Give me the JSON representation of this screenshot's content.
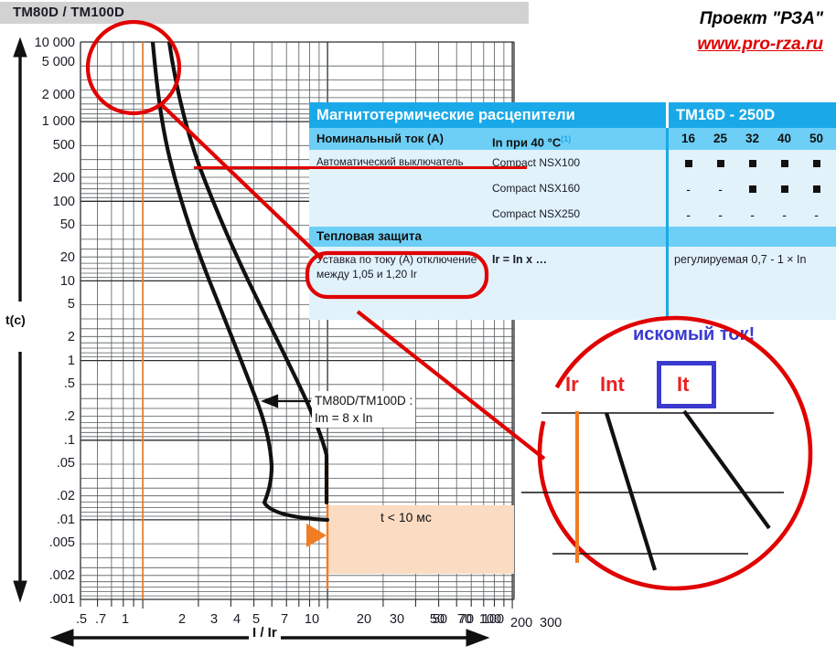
{
  "title_bar": {
    "text": "TM80D / TM100D"
  },
  "brand": {
    "line1": "Проект \"РЗА\"",
    "line2": "www.pro-rza.ru",
    "color": "#e00000"
  },
  "chart_data": {
    "type": "line",
    "title": "TM80D / TM100D",
    "xlabel": "I / Ir",
    "ylabel": "t(c)",
    "xscale": "log",
    "yscale": "log",
    "xlim": [
      0.5,
      300
    ],
    "ylim": [
      0.001,
      10000
    ],
    "grid": true,
    "xticks": [
      ".5",
      ".7",
      "1",
      "2",
      "3",
      "4",
      "5",
      "7",
      "10",
      "20",
      "30",
      "50",
      "70",
      "100",
      "200",
      "300"
    ],
    "xtick_values": [
      0.5,
      0.7,
      1,
      2,
      3,
      4,
      5,
      7,
      10,
      20,
      30,
      50,
      70,
      100,
      200,
      300
    ],
    "yticks": [
      "10 000",
      "5 000",
      "2 000",
      "1 000",
      "500",
      "200",
      "100",
      "50",
      "20",
      "10",
      "5",
      "2",
      "1",
      ".5",
      ".2",
      ".1",
      ".05",
      ".02",
      ".01",
      ".005",
      ".002",
      ".001"
    ],
    "ytick_values": [
      10000,
      5000,
      2000,
      1000,
      500,
      200,
      100,
      50,
      20,
      10,
      5,
      2,
      1,
      0.5,
      0.2,
      0.1,
      0.05,
      0.02,
      0.01,
      0.005,
      0.002,
      0.001
    ],
    "series": [
      {
        "name": "thermal-curve-upper",
        "color": "#111111",
        "points": [
          [
            1.08,
            10000
          ],
          [
            1.15,
            2000
          ],
          [
            1.3,
            500
          ],
          [
            1.6,
            100
          ],
          [
            2.0,
            30
          ],
          [
            2.6,
            10
          ],
          [
            3.5,
            3
          ],
          [
            4.6,
            1
          ],
          [
            6.0,
            0.3
          ],
          [
            7.3,
            0.1
          ],
          [
            8.0,
            0.05
          ],
          [
            8.0,
            0.02
          ]
        ]
      },
      {
        "name": "thermal-curve-lower",
        "color": "#111111",
        "points": [
          [
            1.22,
            10000
          ],
          [
            1.35,
            2000
          ],
          [
            1.6,
            500
          ],
          [
            2.1,
            100
          ],
          [
            2.8,
            30
          ],
          [
            3.8,
            10
          ],
          [
            5.2,
            3
          ],
          [
            7.0,
            1
          ],
          [
            9.0,
            0.3
          ],
          [
            11.0,
            0.1
          ],
          [
            12.5,
            0.04
          ]
        ]
      }
    ],
    "vertical_marker": {
      "name": "Ir-line",
      "x": 1,
      "color": "#f07c24"
    },
    "magnetic_marker": {
      "name": "Im-line",
      "x": 8,
      "color": "#f07c24"
    },
    "shaded_region": {
      "label": "t < 10 мс",
      "x_from": 8,
      "x_to": 300,
      "y_from": 0.0025,
      "y_to": 0.02,
      "color": "#fbdcc3"
    },
    "annotations": [
      {
        "name": "tm-setting",
        "line1": "TM80D/TM100D :",
        "line2": "Im = 8 x In"
      },
      {
        "name": "t-less-10ms",
        "text": "t < 10 мс"
      }
    ]
  },
  "spec_table": {
    "header": {
      "title": "Магнитотермические расцепители",
      "range": "TM16D - 250D"
    },
    "subheader": {
      "col1": "Номинальный ток (А)",
      "col2": "In при 40 °C",
      "footnote": "(1)",
      "ratings": [
        "16",
        "25",
        "32",
        "40",
        "50"
      ]
    },
    "rows": [
      {
        "label": "Автоматический выключатель",
        "device": "Compact NSX100",
        "marks": [
          "sq",
          "sq",
          "sq",
          "sq",
          "sq"
        ]
      },
      {
        "label": "",
        "device": "Compact NSX160",
        "marks": [
          "dash",
          "dash",
          "sq",
          "sq",
          "sq"
        ]
      },
      {
        "label": "",
        "device": "Compact NSX250",
        "marks": [
          "dash",
          "dash",
          "dash",
          "dash",
          "dash"
        ]
      }
    ],
    "section": "Тепловая защита",
    "setting_row": {
      "label_line1": "Уставка по току (А) отключение",
      "label_line2": "между 1,05 и 1,20 Ir",
      "formula": "Ir = In x …",
      "value": "регулируемая 0,7 - 1 × In"
    },
    "colors": {
      "header": "#1aa9e8",
      "subheader": "#6dcff6",
      "body": "#e1f2fb",
      "divider": "#1aa9e8",
      "highlight": "#e00000"
    }
  },
  "magnifier": {
    "title": "искомый ток!",
    "title_color": "#3a3ad0",
    "labels": [
      {
        "name": "Ir",
        "text": "Ir",
        "color": "#ea2020"
      },
      {
        "name": "Int",
        "text": "Int",
        "color": "#ea2020"
      },
      {
        "name": "It",
        "text": "It",
        "color": "#ea2020",
        "boxed": true
      }
    ]
  },
  "axis_labels": {
    "y": "t(c)",
    "x": "I / Ir"
  }
}
